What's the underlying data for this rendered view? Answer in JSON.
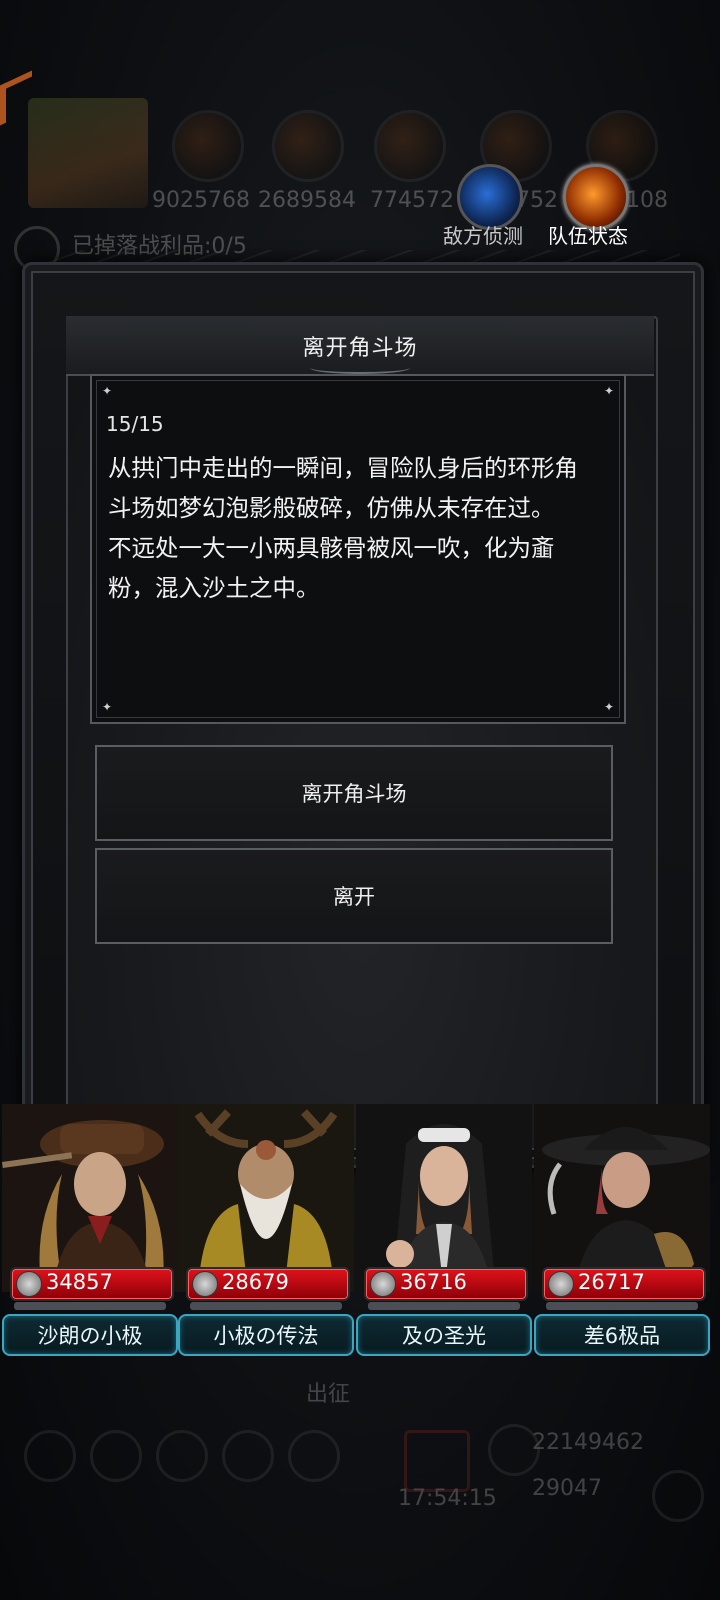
{
  "background_hud": {
    "resource_values": [
      "9025768",
      "2689584",
      "774572",
      "752",
      "108"
    ],
    "loot_text": "已掉落战利品:0/5",
    "bottom_label": "出征",
    "bottom_value_1": "22149462",
    "bottom_value_2": "29047",
    "bottom_timer": "17:54:15"
  },
  "top_buttons": {
    "enemy_scout": "敌方侦测",
    "team_status": "队伍状态"
  },
  "dialog": {
    "title": "离开角斗场",
    "progress": "15/15",
    "story": "从拱门中走出的一瞬间，冒险队身后的环形角斗场如梦幻泡影般破碎，仿佛从未存在过。\n不远处一大一小两具骸骨被风一吹，化为齑粉，混入沙土之中。",
    "choices": [
      "离开角斗场",
      "离开"
    ]
  },
  "heroes": [
    {
      "hp": "34857",
      "name": "沙朗の小极"
    },
    {
      "hp": "28679",
      "name": "小极の传法"
    },
    {
      "hp": "36716",
      "name": "及の圣光"
    },
    {
      "hp": "26717",
      "name": "差6极品"
    }
  ],
  "colors": {
    "hp_bar": "#d0101a",
    "name_border": "#3aa6c2",
    "team_icon": "#ff9a2c",
    "enemy_icon": "#2a6fd6"
  }
}
